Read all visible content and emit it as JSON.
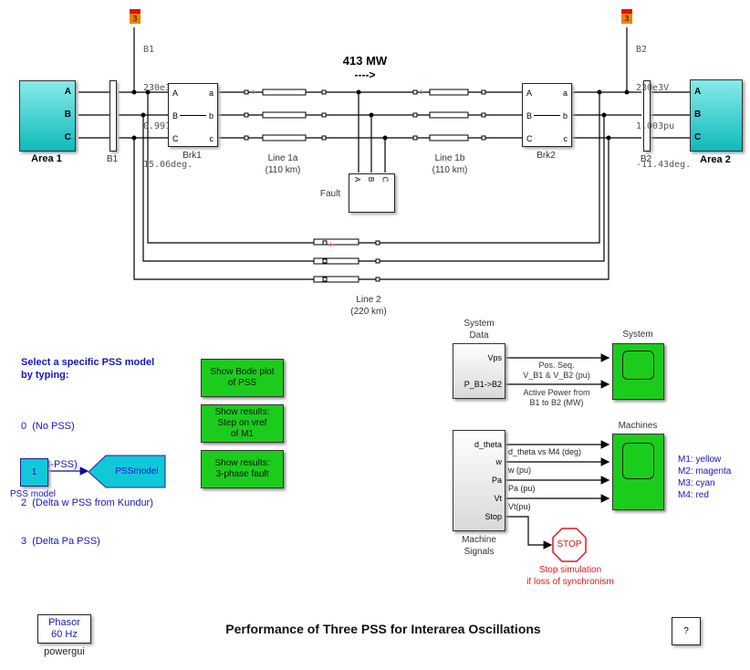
{
  "title": "Performance of Three PSS for Interarea Oscillations",
  "help_button": "?",
  "powergui": {
    "line1": "Phasor",
    "line2": "60 Hz",
    "label": "powergui"
  },
  "areas": [
    {
      "name": "Area 1",
      "ports": [
        "A",
        "B",
        "C"
      ]
    },
    {
      "name": "Area 2",
      "ports": [
        "A",
        "B",
        "C"
      ]
    }
  ],
  "buses": [
    {
      "name": "B1",
      "meas_tag": "3",
      "voltage": "230e3V",
      "magnitude": "0.9916pu",
      "angle": "15.06deg."
    },
    {
      "name": "B2",
      "meas_tag": "3",
      "voltage": "230e3V",
      "magnitude": "1.003pu",
      "angle": "-11.43deg."
    }
  ],
  "breakers": [
    {
      "name": "Brk1",
      "in_ports": [
        "A",
        "B",
        "C"
      ],
      "out_ports": [
        "a",
        "b",
        "c"
      ]
    },
    {
      "name": "Brk2",
      "in_ports": [
        "A",
        "B",
        "C"
      ],
      "out_ports": [
        "a",
        "b",
        "c"
      ]
    }
  ],
  "lines": [
    {
      "name": "Line 1a",
      "length": "(110 km)"
    },
    {
      "name": "Line 1b",
      "length": "(110 km)"
    },
    {
      "name": "Line 2",
      "length": "(220 km)"
    }
  ],
  "fault": {
    "name": "Fault",
    "ports": [
      "A",
      "B",
      "C"
    ]
  },
  "power_flow": {
    "value": "413 MW",
    "arrow": "---->"
  },
  "pss_select": {
    "heading1": "Select a specific PSS model",
    "heading2": "by typing:",
    "options": [
      "0  (No PSS)",
      "1  (MB-PSS)",
      "2  (Delta w PSS from Kundur)",
      "3  (Delta Pa PSS)"
    ]
  },
  "pss_constant": {
    "value": "1",
    "label": "PSS model"
  },
  "pss_goto": {
    "tag": "PSSmodel"
  },
  "buttons": [
    {
      "line1": "Show Bode plot",
      "line2": "of PSS",
      "line3": ""
    },
    {
      "line1": "Show results:",
      "line2": "Step on vref",
      "line3": "of M1"
    },
    {
      "line1": "Show results:",
      "line2": "3-phase fault",
      "line3": ""
    }
  ],
  "system_data": {
    "title1": "System",
    "title2": "Data",
    "ports": [
      "Vps",
      "P_B1->B2"
    ],
    "signal1_line1": "Pos. Seq.",
    "signal1_line2": "V_B1 & V_B2 (pu)",
    "signal2_line1": "Active Power from",
    "signal2_line2": "B1 to B2 (MW)"
  },
  "system_scope": {
    "label": "System"
  },
  "machine_signals": {
    "title1": "Machine",
    "title2": "Signals",
    "ports": [
      "d_theta",
      "w",
      "Pa",
      "Vt",
      "Stop"
    ],
    "signals": [
      "d_theta vs M4 (deg)",
      "w (pu)",
      "Pa (pu)",
      "Vt(pu)"
    ]
  },
  "machines_scope": {
    "label": "Machines"
  },
  "legend": [
    "M1: yellow",
    "M2: magenta",
    "M3: cyan",
    "M4: red"
  ],
  "stop_block": {
    "label": "STOP",
    "caption1": "Stop simulation",
    "caption2": "if loss of synchronism"
  },
  "colors": {
    "green": "#1ccc1c",
    "cyan": "#10b9b9",
    "blue_text": "#1515c8",
    "red_text": "#e0161e"
  }
}
